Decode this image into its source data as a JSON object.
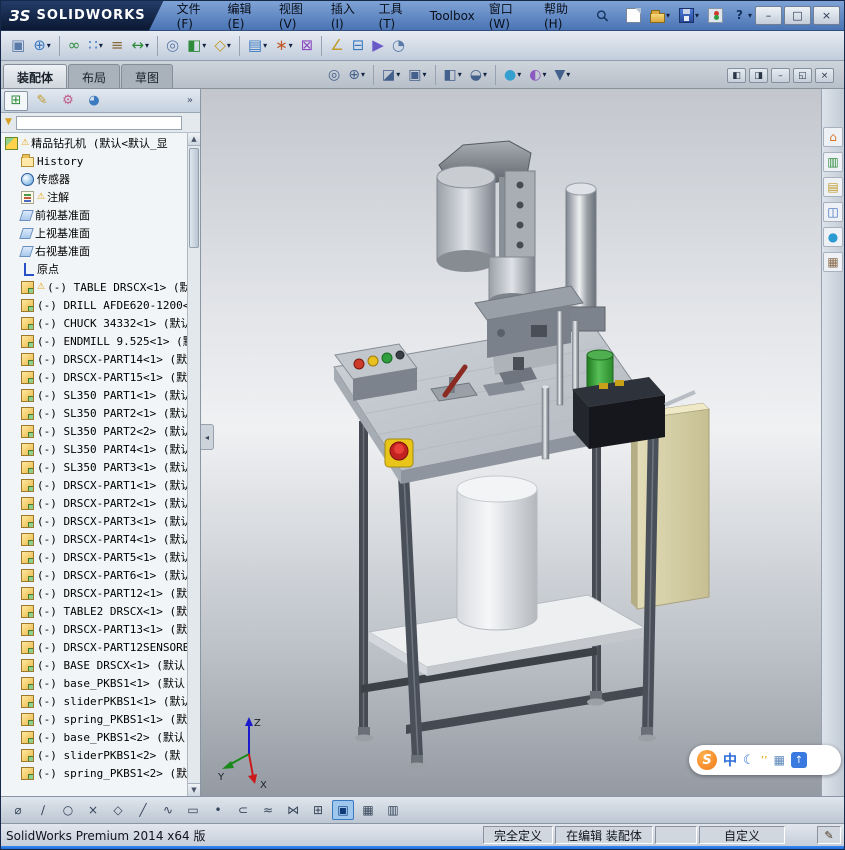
{
  "glyphs": {
    "warning": "⚠",
    "dropdown": "▾",
    "overflow": "»",
    "collapse_left": "◂",
    "scroll_up": "▲",
    "scroll_down": "▼",
    "funnel": "▼"
  },
  "titlebar": {
    "logo_mark": "ЗS",
    "logo_text": "SOLIDWORKS",
    "menus": [
      "文件(F)",
      "编辑(E)",
      "视图(V)",
      "插入(I)",
      "工具(T)",
      "Toolbox",
      "窗口(W)",
      "帮助(H)"
    ],
    "quickbar": [
      {
        "name": "new-document",
        "kind": "new"
      },
      {
        "name": "open-document",
        "kind": "open",
        "dd": true
      },
      {
        "name": "save-document",
        "kind": "save",
        "dd": true
      },
      {
        "name": "status-lights",
        "kind": "lights"
      },
      {
        "name": "help",
        "kind": "help",
        "glyph": "?",
        "dd": true
      }
    ],
    "window_buttons": [
      {
        "name": "minimize",
        "glyph": "–"
      },
      {
        "name": "maximize",
        "glyph": "□"
      },
      {
        "name": "close",
        "glyph": "×"
      }
    ]
  },
  "toolbar": [
    {
      "name": "edit-component",
      "glyph": "▣",
      "color": "#5a7aa8"
    },
    {
      "name": "insert-component",
      "glyph": "⊕",
      "color": "#3a7ac0",
      "dd": true
    },
    {
      "sep": true
    },
    {
      "name": "mate",
      "glyph": "∞",
      "color": "#2e8b3a"
    },
    {
      "name": "linear-component-pattern",
      "glyph": "∷",
      "color": "#3a7ac0",
      "dd": true
    },
    {
      "name": "smart-fasteners",
      "glyph": "≡",
      "color": "#8a6a3a"
    },
    {
      "name": "move-component",
      "glyph": "↔",
      "color": "#2e8b3a",
      "dd": true
    },
    {
      "sep": true
    },
    {
      "name": "show-hidden-components",
      "glyph": "◎",
      "color": "#5a7aa8"
    },
    {
      "name": "assembly-features",
      "glyph": "◧",
      "color": "#2e8b3a",
      "dd": true
    },
    {
      "name": "reference-geometry",
      "glyph": "◇",
      "color": "#c09a2a",
      "dd": true
    },
    {
      "sep": true
    },
    {
      "name": "bill-of-materials",
      "glyph": "▤",
      "color": "#3a7ac0",
      "dd": true
    },
    {
      "name": "exploded-view",
      "glyph": "∗",
      "color": "#c05a2a",
      "dd": true
    },
    {
      "name": "interference-detection",
      "glyph": "⊠",
      "color": "#8a4ac0"
    },
    {
      "sep": true
    },
    {
      "name": "measure",
      "glyph": "∠",
      "color": "#c09a2a"
    },
    {
      "name": "section-view",
      "glyph": "⊟",
      "color": "#3a7ac0"
    },
    {
      "name": "motion-study",
      "glyph": "▶",
      "color": "#6a5ac8"
    },
    {
      "name": "screen-capture",
      "glyph": "◔",
      "color": "#5a7aa8"
    }
  ],
  "tabs": [
    {
      "label": "装配体",
      "active": true
    },
    {
      "label": "布局",
      "active": false
    },
    {
      "label": "草图",
      "active": false
    }
  ],
  "headsup": [
    {
      "name": "zoom-to-fit",
      "glyph": "◎",
      "color": "#44608c"
    },
    {
      "name": "zoom-to-area",
      "glyph": "⊕",
      "color": "#44608c",
      "dd": true
    },
    {
      "sep": true
    },
    {
      "name": "section-view",
      "glyph": "◪",
      "color": "#44608c",
      "dd": true
    },
    {
      "name": "view-orientation",
      "glyph": "▣",
      "color": "#44608c",
      "dd": true
    },
    {
      "sep": true
    },
    {
      "name": "display-style",
      "glyph": "◧",
      "color": "#44608c",
      "dd": true
    },
    {
      "name": "hide-show-items",
      "glyph": "◒",
      "color": "#44608c",
      "dd": true
    },
    {
      "sep": true
    },
    {
      "name": "edit-appearance",
      "glyph": "●",
      "color": "#35a0d0",
      "dd": true
    },
    {
      "name": "apply-scene",
      "glyph": "◐",
      "color": "#8a5ac0",
      "dd": true
    },
    {
      "name": "view-settings",
      "glyph": "▼",
      "color": "#44608c",
      "dd": true
    }
  ],
  "doc_controls": [
    {
      "name": "pane-split-left",
      "glyph": "◧"
    },
    {
      "name": "pane-split-right",
      "glyph": "◨"
    },
    {
      "name": "minimize-document",
      "glyph": "–"
    },
    {
      "name": "restore-document",
      "glyph": "◱"
    },
    {
      "name": "close-document",
      "glyph": "×"
    }
  ],
  "left_panel": {
    "tabs": [
      {
        "name": "featuremanager-tab",
        "glyph": "⊞",
        "color": "#2e8b3a",
        "active": true
      },
      {
        "name": "propertymanager-tab",
        "glyph": "✎",
        "color": "#c09a2a"
      },
      {
        "name": "configurationmanager-tab",
        "glyph": "⚙",
        "color": "#c05a8a"
      },
      {
        "name": "displaymanager-tab",
        "glyph": "◕",
        "color": "#3a7ac0"
      }
    ]
  },
  "tree": {
    "items": [
      {
        "icon": "assembly",
        "warn": true,
        "root": true,
        "label": "精品钻孔机 (默认<默认_显"
      },
      {
        "icon": "history",
        "label": "History"
      },
      {
        "icon": "sensors",
        "label": "传感器"
      },
      {
        "icon": "annotations",
        "warn": true,
        "label": "注解"
      },
      {
        "icon": "plane",
        "label": "前视基准面"
      },
      {
        "icon": "plane",
        "label": "上视基准面"
      },
      {
        "icon": "plane",
        "label": "右视基准面"
      },
      {
        "icon": "origin",
        "label": "原点"
      },
      {
        "icon": "component",
        "warn": true,
        "label": "(-) TABLE DRSCX<1> (默"
      },
      {
        "icon": "component",
        "label": "(-) DRILL AFDE620-1200<"
      },
      {
        "icon": "component",
        "label": "(-) CHUCK 34332<1> (默认"
      },
      {
        "icon": "component",
        "label": "(-) ENDMILL 9.525<1> (默"
      },
      {
        "icon": "component",
        "label": "(-) DRSCX-PART14<1> (默"
      },
      {
        "icon": "component",
        "label": "(-) DRSCX-PART15<1> (默认"
      },
      {
        "icon": "component",
        "label": "(-) SL350 PART1<1> (默认"
      },
      {
        "icon": "component",
        "label": "(-) SL350 PART2<1> (默认"
      },
      {
        "icon": "component",
        "label": "(-) SL350 PART2<2> (默认"
      },
      {
        "icon": "component",
        "label": "(-) SL350 PART4<1> (默认"
      },
      {
        "icon": "component",
        "label": "(-) SL350 PART3<1> (默认"
      },
      {
        "icon": "component",
        "label": "(-) DRSCX-PART1<1> (默认"
      },
      {
        "icon": "component",
        "label": "(-) DRSCX-PART2<1> (默认"
      },
      {
        "icon": "component",
        "label": "(-) DRSCX-PART3<1> (默认"
      },
      {
        "icon": "component",
        "label": "(-) DRSCX-PART4<1> (默认"
      },
      {
        "icon": "component",
        "label": "(-) DRSCX-PART5<1> (默认"
      },
      {
        "icon": "component",
        "label": "(-) DRSCX-PART6<1> (默认"
      },
      {
        "icon": "component",
        "label": "(-) DRSCX-PART12<1> (默"
      },
      {
        "icon": "component",
        "label": "(-) TABLE2 DRSCX<1> (默"
      },
      {
        "icon": "component",
        "label": "(-) DRSCX-PART13<1> (默"
      },
      {
        "icon": "component",
        "label": "(-) DRSCX-PART12SENSORB"
      },
      {
        "icon": "component",
        "label": "(-) BASE DRSCX<1> (默认"
      },
      {
        "icon": "component",
        "label": "(-) base_PKBS1<1> (默认"
      },
      {
        "icon": "component",
        "label": "(-) sliderPKBS1<1> (默认"
      },
      {
        "icon": "component",
        "label": "(-) spring_PKBS1<1> (默"
      },
      {
        "icon": "component",
        "label": "(-) base_PKBS1<2> (默认"
      },
      {
        "icon": "component",
        "label": "(-) sliderPKBS1<2> (默"
      },
      {
        "icon": "component",
        "label": "(-) spring_PKBS1<2> (默"
      }
    ]
  },
  "viewport": {
    "triad": {
      "x": "X",
      "y": "Y",
      "z": "Z"
    }
  },
  "taskpane": [
    {
      "name": "solidworks-resources",
      "glyph": "⌂",
      "color": "#d8742a"
    },
    {
      "name": "design-library",
      "glyph": "▥",
      "color": "#2e8b3a"
    },
    {
      "name": "file-explorer",
      "glyph": "▤",
      "color": "#c09a2a"
    },
    {
      "name": "view-palette",
      "glyph": "◫",
      "color": "#3a6ac0"
    },
    {
      "name": "appearances-scenes",
      "glyph": "●",
      "color": "#2a9ad0"
    },
    {
      "name": "custom-properties",
      "glyph": "▦",
      "color": "#8a6a4a"
    }
  ],
  "sketchbar": [
    {
      "name": "smart-dimension",
      "glyph": "⌀"
    },
    {
      "name": "line",
      "glyph": "∕"
    },
    {
      "name": "circle",
      "glyph": "○"
    },
    {
      "name": "trim-entities",
      "glyph": "×"
    },
    {
      "name": "polygon",
      "glyph": "◇"
    },
    {
      "name": "centerline",
      "glyph": "╱"
    },
    {
      "name": "spline",
      "glyph": "∿"
    },
    {
      "name": "corner-rectangle",
      "glyph": "▭"
    },
    {
      "name": "point",
      "glyph": "•"
    },
    {
      "name": "convert-entities",
      "glyph": "⊂"
    },
    {
      "name": "offset-entities",
      "glyph": "≈"
    },
    {
      "name": "mirror-entities",
      "glyph": "⋈"
    },
    {
      "name": "sketch-pattern",
      "glyph": "⊞"
    },
    {
      "name": "normal-sketch",
      "glyph": "▣",
      "active": true
    },
    {
      "name": "grid-snap",
      "glyph": "▦"
    },
    {
      "name": "tables",
      "glyph": "▥"
    }
  ],
  "statusbar": {
    "left": "SolidWorks Premium 2014 x64 版",
    "segments": [
      "完全定义",
      "在编辑 装配体",
      "",
      "自定义"
    ],
    "edit_icon": "✎"
  },
  "ime": {
    "brand": "S",
    "lang": "中",
    "moon": "☾",
    "dots": "’’",
    "keyboard": "▦",
    "tool": "↑"
  }
}
